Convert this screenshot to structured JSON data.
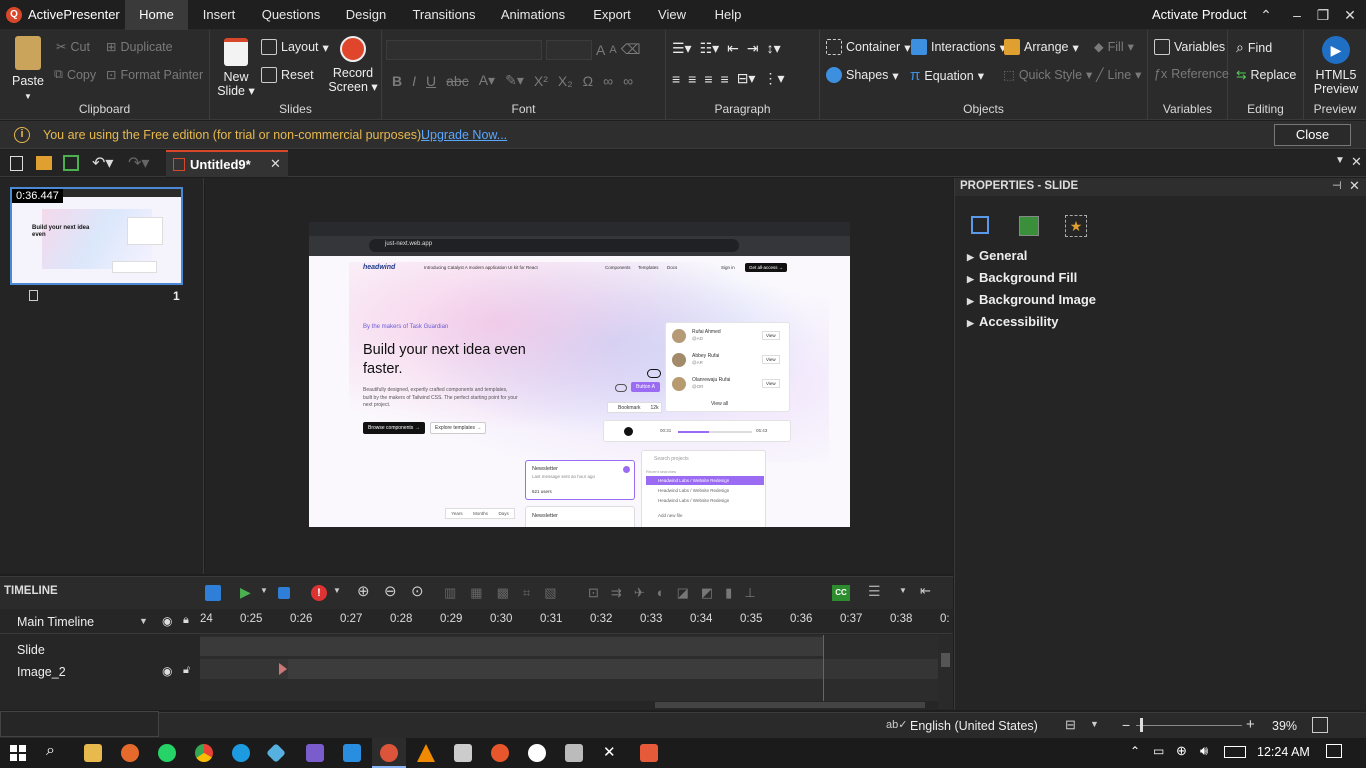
{
  "app": {
    "title": "ActivePresenter",
    "activate": "Activate Product"
  },
  "menu": [
    "Home",
    "Insert",
    "Questions",
    "Design",
    "Transitions",
    "Animations",
    "Export",
    "View",
    "Help"
  ],
  "ribbon": {
    "clipboard": {
      "label": "Clipboard",
      "paste": "Paste",
      "cut": "Cut",
      "copy": "Copy",
      "duplicate": "Duplicate",
      "format_painter": "Format Painter"
    },
    "slides": {
      "label": "Slides",
      "new_slide_1": "New",
      "new_slide_2": "Slide",
      "layout": "Layout",
      "reset": "Reset",
      "record_1": "Record",
      "record_2": "Screen"
    },
    "font": {
      "label": "Font"
    },
    "paragraph": {
      "label": "Paragraph"
    },
    "objects": {
      "label": "Objects",
      "container": "Container",
      "interactions": "Interactions",
      "arrange": "Arrange",
      "fill": "Fill",
      "shapes": "Shapes",
      "equation": "Equation",
      "quick_style": "Quick Style",
      "line": "Line"
    },
    "variables": {
      "label": "Variables",
      "variables": "Variables",
      "reference": "Reference"
    },
    "editing": {
      "label": "Editing",
      "find": "Find",
      "replace": "Replace"
    },
    "preview": {
      "label": "Preview",
      "html5_1": "HTML5",
      "html5_2": "Preview"
    }
  },
  "notice": {
    "text": "You are using the Free edition (for trial or non-commercial purposes).",
    "link": "Upgrade Now...",
    "close": "Close"
  },
  "document": {
    "tab": "Untitled9*"
  },
  "slide_panel": {
    "time": "0:36.447",
    "number": "1"
  },
  "slide_content": {
    "url": "just-next.web.app",
    "logo": "headwind",
    "announce": "Introducing Catalyst  A modern application UI kit for React",
    "nav": [
      "Components",
      "Templates",
      "Docs"
    ],
    "signin": "Sign in",
    "cta": "Get all-access →",
    "eyebrow": "By the makers of Task Guardian",
    "headline_1": "Build your next idea even",
    "headline_2": "faster.",
    "body": "Beautifully designed, expertly crafted components and templates, built by the makers of Tailwind CSS. The perfect starting point for your next project.",
    "browse": "Browse components →",
    "explore": "Explore templates →",
    "people": [
      {
        "name": "Rufai Ahmed",
        "handle": "@AD"
      },
      {
        "name": "Abbey Rufai",
        "handle": "@AR"
      },
      {
        "name": "Olanrewaju Rufai",
        "handle": "@OR"
      }
    ],
    "view": "View",
    "view_all": "View all",
    "button_a": "Button A",
    "bookmark": "Bookmark",
    "bookmark_count": "12k",
    "player_start": "00:31",
    "player_end": "05:43",
    "newsletter": "Newsletter",
    "newsletter_sub": "Last message sent an hour ago",
    "newsletter_users": "621 users",
    "search_placeholder": "Search projects",
    "recent": "Recent searches",
    "results": [
      "Headwind Labs / Website Redesign",
      "Headwind Labs / Website Redesign",
      "Headwind Labs / Website Redesign"
    ],
    "add_file": "Add new file",
    "periods": [
      "Years",
      "Months",
      "Days"
    ]
  },
  "properties": {
    "title": "PROPERTIES - SLIDE",
    "sections": [
      "General",
      "Background Fill",
      "Background Image",
      "Accessibility"
    ]
  },
  "timeline": {
    "title": "TIMELINE",
    "main": "Main Timeline",
    "ticks": [
      "24",
      "0:25",
      "0:26",
      "0:27",
      "0:28",
      "0:29",
      "0:30",
      "0:31",
      "0:32",
      "0:33",
      "0:34",
      "0:35",
      "0:36",
      "0:37",
      "0:38",
      "0:"
    ],
    "tracks": [
      "Slide",
      "Image_2"
    ]
  },
  "status": {
    "language": "English (United States)",
    "zoom": "39%"
  },
  "taskbar": {
    "time": "12:24 AM"
  }
}
